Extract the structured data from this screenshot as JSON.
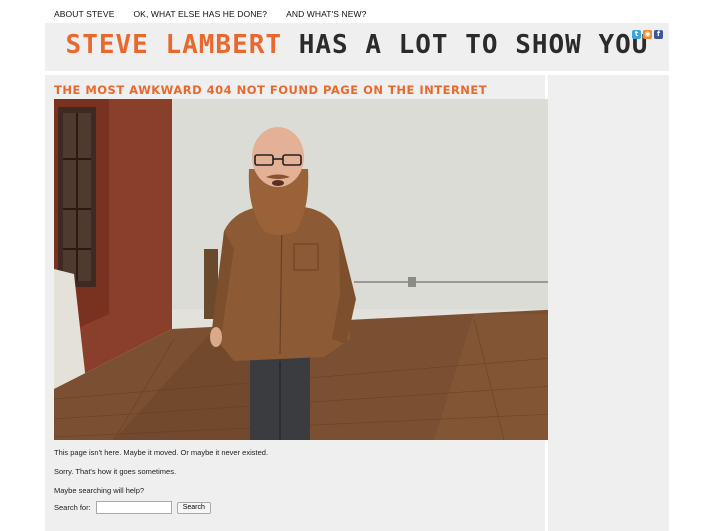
{
  "nav": {
    "items": [
      "ABOUT STEVE",
      "OK, WHAT ELSE HAS HE DONE?",
      "AND WHAT'S NEW?"
    ]
  },
  "banner": {
    "title_orange": "STEVE LAMBERT",
    "title_dark": "HAS A LOT TO SHOW YOU",
    "social_icons": [
      "twitter-icon",
      "rss-icon",
      "facebook-icon"
    ]
  },
  "main": {
    "headline": "THE MOST AWKWARD 404 NOT FOUND PAGE ON THE INTERNET",
    "paragraphs": [
      "This page isn't here. Maybe it moved. Or maybe it never existed.",
      "Sorry. That's how it goes sometimes.",
      "Maybe searching will help?"
    ],
    "search": {
      "label": "Search for:",
      "placeholder": "",
      "button": "Search"
    }
  },
  "colors": {
    "accent": "#e8692d",
    "dark": "#2b2b2b",
    "panel": "#efefef"
  }
}
